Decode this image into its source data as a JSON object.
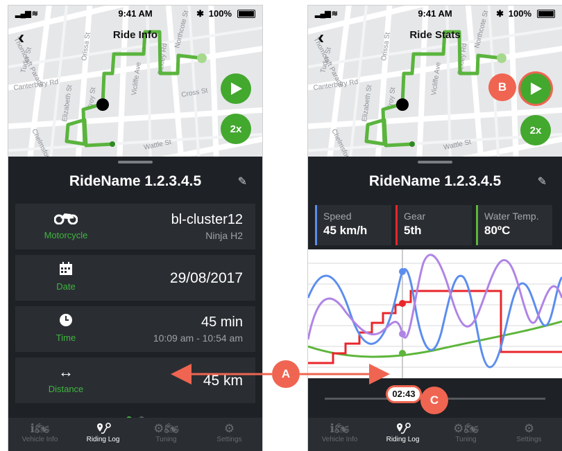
{
  "status_bar": {
    "time": "9:41 AM",
    "battery": "100%"
  },
  "left_screen": {
    "title": "Ride Info",
    "ride_name": "RideName 1.2.3.4.5",
    "rows": [
      {
        "label": "Motorcycle",
        "value": "bl-cluster12",
        "sub": "Ninja H2",
        "icon": "motorcycle-icon"
      },
      {
        "label": "Date",
        "value": "29/08/2017",
        "sub": "",
        "icon": "calendar-icon"
      },
      {
        "label": "Time",
        "value": "45 min",
        "sub": "10:09 am - 10:54 am",
        "icon": "clock-icon"
      },
      {
        "label": "Distance",
        "value": "45 km",
        "sub": "",
        "icon": "distance-arrows-icon"
      }
    ],
    "speed_button": "2x"
  },
  "right_screen": {
    "title": "Ride Stats",
    "ride_name": "RideName 1.2.3.4.5",
    "stats": [
      {
        "label": "Speed",
        "value": "45 km/h",
        "color": "#5b8dee"
      },
      {
        "label": "Gear",
        "value": "5th",
        "color": "#e8262b"
      },
      {
        "label": "Water Temp.",
        "value": "80ºC",
        "color": "#5db53a"
      }
    ],
    "speed_button": "2x",
    "timestamp": "02:43"
  },
  "tabs": [
    {
      "label": "Vehicle Info",
      "icon": "motorcycle-info-icon",
      "active": false
    },
    {
      "label": "Riding Log",
      "icon": "route-pin-icon",
      "active": true
    },
    {
      "label": "Tuning",
      "icon": "tuning-gear-icon",
      "active": false
    },
    {
      "label": "Settings",
      "icon": "settings-gear-icon",
      "active": false
    }
  ],
  "map_streets": [
    "Thorncraft Parade",
    "Canterbury Rd",
    "Tudor St",
    "Cross St",
    "Northcote St",
    "Troy St",
    "Vicliffe Ave",
    "Bexley Rd",
    "Elizabeth St",
    "Chelmsford Ave",
    "Wattle St",
    "Orissa St"
  ],
  "annotations": {
    "a": "A",
    "b": "B",
    "c": "C"
  },
  "colors": {
    "accent_green": "#3fb53d",
    "route_green": "#5ab43d",
    "annotation": "#ef6551",
    "dark_bg": "#1e2125",
    "card_bg": "#2a2e33"
  }
}
